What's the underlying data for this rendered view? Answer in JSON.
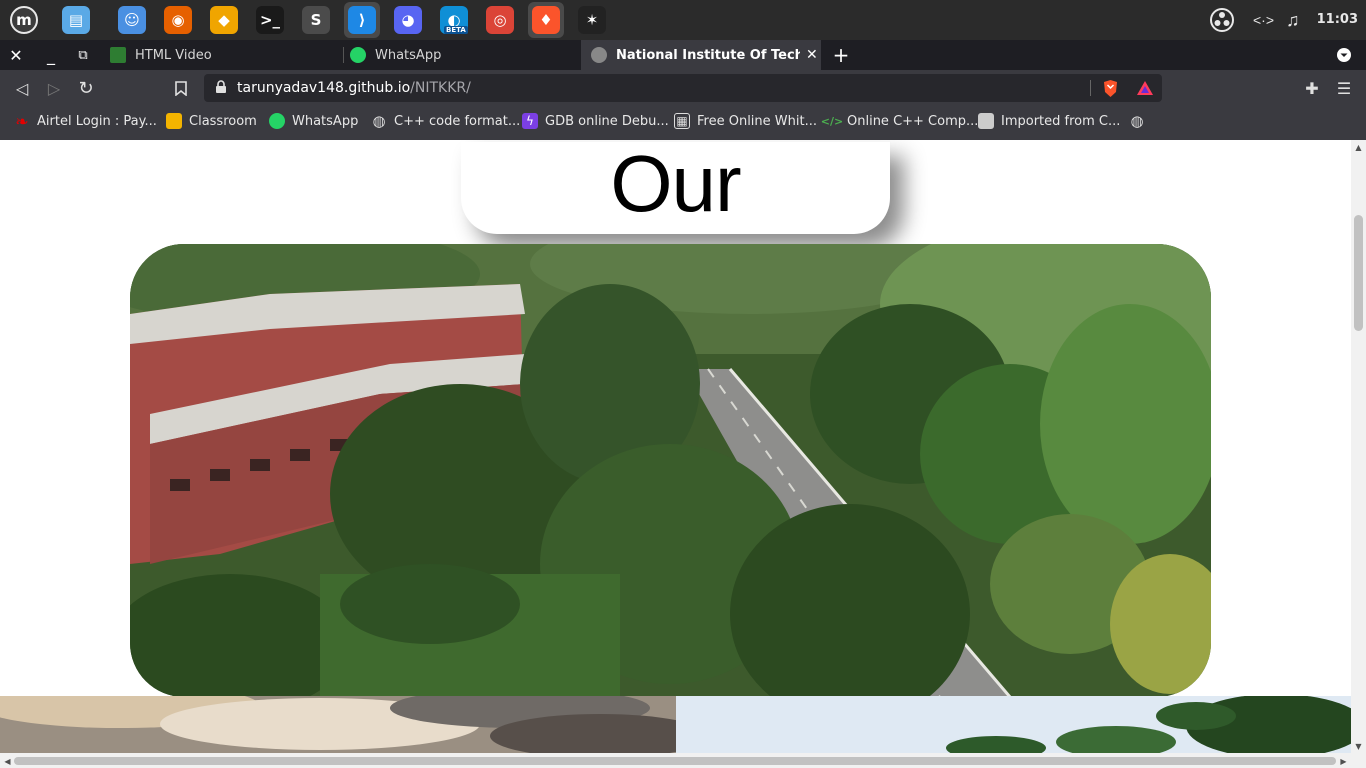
{
  "os_panel": {
    "apps": [
      {
        "name": "linux-mint-menu-icon",
        "glyph": "m",
        "color": "#3c3c3c"
      },
      {
        "name": "files-icon",
        "glyph": "▤",
        "color": "#5aa9e6"
      },
      {
        "name": "finder-icon",
        "glyph": "☺",
        "color": "#4a90e2"
      },
      {
        "name": "firefox-icon",
        "glyph": "◉",
        "color": "#e66000"
      },
      {
        "name": "genie-lamp-icon",
        "glyph": "◆",
        "color": "#f0a500"
      },
      {
        "name": "terminal-icon",
        "glyph": ">_",
        "color": "#1a1a1a"
      },
      {
        "name": "sublime-text-icon",
        "glyph": "S",
        "color": "#4b4b4b"
      },
      {
        "name": "vscode-icon",
        "glyph": "⟩",
        "color": "#1e88e5"
      },
      {
        "name": "discord-icon",
        "glyph": "◕",
        "color": "#5865f2"
      },
      {
        "name": "edge-beta-icon",
        "glyph": "◐",
        "color": "#0f8fd6"
      },
      {
        "name": "chrome-icon",
        "glyph": "◎",
        "color": "#db4437"
      },
      {
        "name": "brave-icon",
        "glyph": "♦",
        "color": "#fb542b"
      },
      {
        "name": "obs-icon",
        "glyph": "✶",
        "color": "#222222"
      }
    ],
    "edge_badge": "BETA",
    "clock": "11:03"
  },
  "tabs": [
    {
      "title": "HTML Video",
      "favicon_color": "#2e7d32"
    },
    {
      "title": "WhatsApp",
      "favicon_color": "#25d366"
    },
    {
      "title": "National Institute Of Technolo",
      "favicon_color": "#888888"
    }
  ],
  "address_bar": {
    "domain": "tarunyadav148.github.io",
    "path": "/NITKKR/"
  },
  "bookmarks": [
    {
      "label": "Airtel Login : Pay...",
      "icon": "airtel-icon",
      "color": "#e40000"
    },
    {
      "label": "Classroom",
      "icon": "classroom-icon",
      "color": "#f4b400"
    },
    {
      "label": "WhatsApp",
      "icon": "whatsapp-icon",
      "color": "#25d366"
    },
    {
      "label": "C++ code format...",
      "icon": "globe-icon",
      "color": "#dddddd"
    },
    {
      "label": "GDB online Debu...",
      "icon": "gdb-icon",
      "color": "#7b3fe4"
    },
    {
      "label": "Free Online Whit...",
      "icon": "whiteboard-icon",
      "color": "#dddddd"
    },
    {
      "label": "Online C++ Comp...",
      "icon": "code-icon",
      "color": "#4caf50"
    },
    {
      "label": "Imported from C...",
      "icon": "folder-icon",
      "color": "#cccccc"
    }
  ],
  "page": {
    "heading": "Our Campus"
  }
}
